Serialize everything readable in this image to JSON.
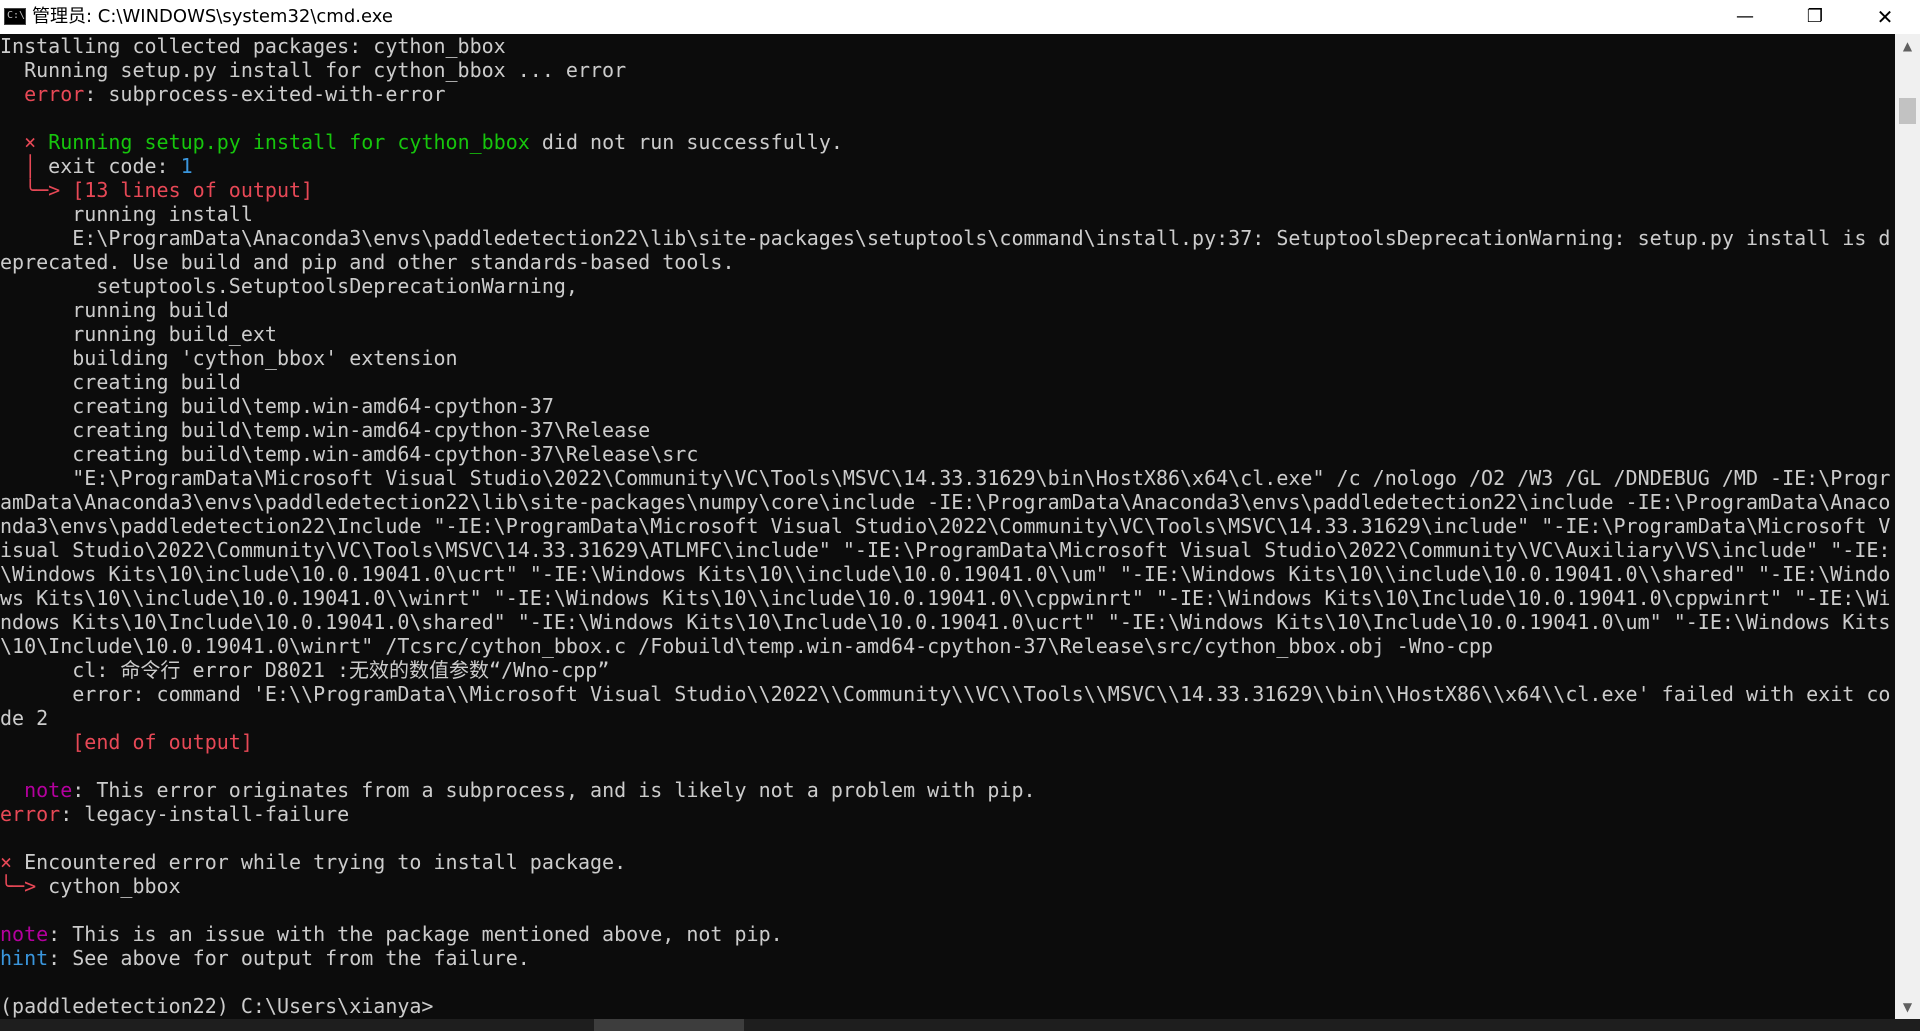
{
  "window": {
    "title": "管理员: C:\\WINDOWS\\system32\\cmd.exe",
    "icon": "cmd-icon",
    "icon_glyph": "C:\\",
    "minimize_label": "—",
    "maximize_label": "❐",
    "close_label": "✕"
  },
  "colors": {
    "error_red": "#e74856",
    "success_green": "#16c60c",
    "note_magenta": "#b4009e",
    "hint_cyan": "#3a96dd",
    "console_text": "#cccccc",
    "console_background": "#0c0c0c"
  },
  "terminal": {
    "lines": [
      [
        {
          "t": "Installing collected packages: cython_bbox"
        }
      ],
      [
        {
          "t": "  Running setup.py install for cython_bbox ... error"
        }
      ],
      [
        {
          "t": "  "
        },
        {
          "t": "error",
          "c": "red"
        },
        {
          "t": ": subprocess-exited-with-error"
        }
      ],
      [
        {
          "t": ""
        }
      ],
      [
        {
          "t": "  "
        },
        {
          "t": "×",
          "c": "red"
        },
        {
          "t": " "
        },
        {
          "t": "Running setup.py install for cython_bbox",
          "c": "green"
        },
        {
          "t": " did not run successfully."
        }
      ],
      [
        {
          "t": "  "
        },
        {
          "t": "│",
          "c": "red"
        },
        {
          "t": " exit code: "
        },
        {
          "t": "1",
          "c": "cyan"
        }
      ],
      [
        {
          "t": "  "
        },
        {
          "t": "╰─>",
          "c": "red"
        },
        {
          "t": " "
        },
        {
          "t": "[13 lines of output]",
          "c": "red"
        }
      ],
      [
        {
          "t": "      running install"
        }
      ],
      [
        {
          "t": "      E:\\ProgramData\\Anaconda3\\envs\\paddledetection22\\lib\\site-packages\\setuptools\\command\\install.py:37: SetuptoolsDeprecationWarning: setup.py install is d"
        }
      ],
      [
        {
          "t": "eprecated. Use build and pip and other standards-based tools."
        }
      ],
      [
        {
          "t": "        setuptools.SetuptoolsDeprecationWarning,"
        }
      ],
      [
        {
          "t": "      running build"
        }
      ],
      [
        {
          "t": "      running build_ext"
        }
      ],
      [
        {
          "t": "      building 'cython_bbox' extension"
        }
      ],
      [
        {
          "t": "      creating build"
        }
      ],
      [
        {
          "t": "      creating build\\temp.win-amd64-cpython-37"
        }
      ],
      [
        {
          "t": "      creating build\\temp.win-amd64-cpython-37\\Release"
        }
      ],
      [
        {
          "t": "      creating build\\temp.win-amd64-cpython-37\\Release\\src"
        }
      ],
      [
        {
          "t": "      \"E:\\ProgramData\\Microsoft Visual Studio\\2022\\Community\\VC\\Tools\\MSVC\\14.33.31629\\bin\\HostX86\\x64\\cl.exe\" /c /nologo /O2 /W3 /GL /DNDEBUG /MD -IE:\\Progr"
        }
      ],
      [
        {
          "t": "amData\\Anaconda3\\envs\\paddledetection22\\lib\\site-packages\\numpy\\core\\include -IE:\\ProgramData\\Anaconda3\\envs\\paddledetection22\\include -IE:\\ProgramData\\Anaco"
        }
      ],
      [
        {
          "t": "nda3\\envs\\paddledetection22\\Include \"-IE:\\ProgramData\\Microsoft Visual Studio\\2022\\Community\\VC\\Tools\\MSVC\\14.33.31629\\include\" \"-IE:\\ProgramData\\Microsoft V"
        }
      ],
      [
        {
          "t": "isual Studio\\2022\\Community\\VC\\Tools\\MSVC\\14.33.31629\\ATLMFC\\include\" \"-IE:\\ProgramData\\Microsoft Visual Studio\\2022\\Community\\VC\\Auxiliary\\VS\\include\" \"-IE:"
        }
      ],
      [
        {
          "t": "\\Windows Kits\\10\\include\\10.0.19041.0\\ucrt\" \"-IE:\\Windows Kits\\10\\\\include\\10.0.19041.0\\\\um\" \"-IE:\\Windows Kits\\10\\\\include\\10.0.19041.0\\\\shared\" \"-IE:\\Windo"
        }
      ],
      [
        {
          "t": "ws Kits\\10\\\\include\\10.0.19041.0\\\\winrt\" \"-IE:\\Windows Kits\\10\\\\include\\10.0.19041.0\\\\cppwinrt\" \"-IE:\\Windows Kits\\10\\Include\\10.0.19041.0\\cppwinrt\" \"-IE:\\Wi"
        }
      ],
      [
        {
          "t": "ndows Kits\\10\\Include\\10.0.19041.0\\shared\" \"-IE:\\Windows Kits\\10\\Include\\10.0.19041.0\\ucrt\" \"-IE:\\Windows Kits\\10\\Include\\10.0.19041.0\\um\" \"-IE:\\Windows Kits"
        }
      ],
      [
        {
          "t": "\\10\\Include\\10.0.19041.0\\winrt\" /Tcsrc/cython_bbox.c /Fobuild\\temp.win-amd64-cpython-37\\Release\\src/cython_bbox.obj -Wno-cpp"
        }
      ],
      [
        {
          "t": "      cl: 命令行 error D8021 :无效的数值参数“/Wno-cpp”"
        }
      ],
      [
        {
          "t": "      error: command 'E:\\\\ProgramData\\\\Microsoft Visual Studio\\\\2022\\\\Community\\\\VC\\\\Tools\\\\MSVC\\\\14.33.31629\\\\bin\\\\HostX86\\\\x64\\\\cl.exe' failed with exit co"
        }
      ],
      [
        {
          "t": "de 2"
        }
      ],
      [
        {
          "t": "      "
        },
        {
          "t": "[end of output]",
          "c": "red"
        }
      ],
      [
        {
          "t": ""
        }
      ],
      [
        {
          "t": "  "
        },
        {
          "t": "note",
          "c": "magenta"
        },
        {
          "t": ": This error originates from a subprocess, and is likely not a problem with pip."
        }
      ],
      [
        {
          "t": "error",
          "c": "red"
        },
        {
          "t": ": legacy-install-failure"
        }
      ],
      [
        {
          "t": ""
        }
      ],
      [
        {
          "t": "×",
          "c": "red"
        },
        {
          "t": " Encountered error while trying to install package."
        }
      ],
      [
        {
          "t": "╰─>",
          "c": "red"
        },
        {
          "t": " cython_bbox"
        }
      ],
      [
        {
          "t": ""
        }
      ],
      [
        {
          "t": "note",
          "c": "magenta"
        },
        {
          "t": ": This is an issue with the package mentioned above, not pip."
        }
      ],
      [
        {
          "t": "hint",
          "c": "cyan"
        },
        {
          "t": ": See above for output from the failure."
        }
      ],
      [
        {
          "t": ""
        }
      ],
      [
        {
          "t": "(paddledetection22) C:\\Users\\xianya>"
        }
      ]
    ]
  },
  "scrollbar": {
    "up_arrow": "▲",
    "down_arrow": "▼",
    "up_icon": "scroll-up-arrow-icon",
    "down_icon": "scroll-down-arrow-icon"
  }
}
